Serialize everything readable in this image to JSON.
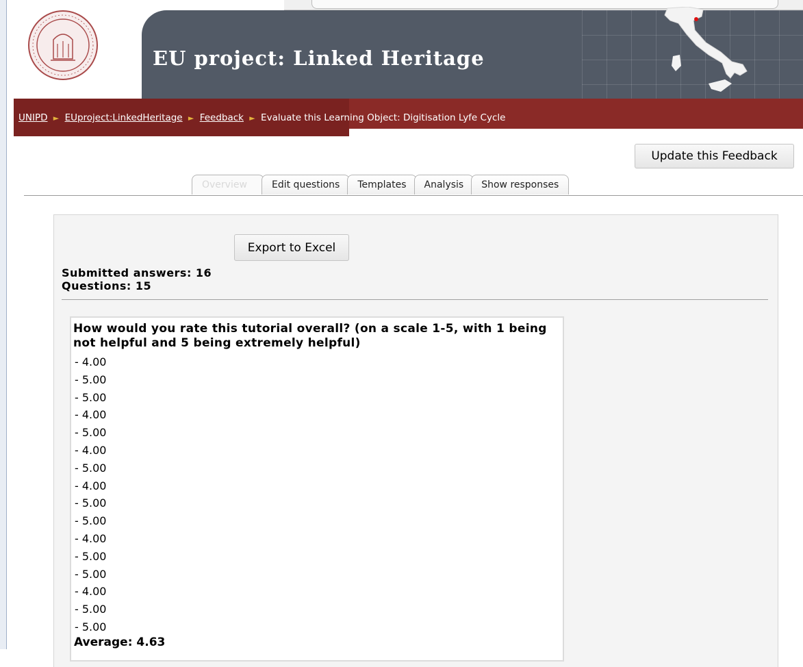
{
  "header": {
    "title": "EU project: Linked Heritage"
  },
  "breadcrumb": {
    "items": [
      {
        "label": "UNIPD",
        "link": true
      },
      {
        "label": "EUproject:LinkedHeritage",
        "link": true
      },
      {
        "label": "Feedback",
        "link": true
      },
      {
        "label": "Evaluate this Learning Object: Digitisation Lyfe Cycle",
        "link": false
      }
    ]
  },
  "actions": {
    "update_label": "Update this Feedback",
    "export_label": "Export to Excel"
  },
  "tabs": [
    {
      "label": "Overview",
      "active": true
    },
    {
      "label": "Edit questions",
      "active": false
    },
    {
      "label": "Templates",
      "active": false
    },
    {
      "label": "Analysis",
      "active": false
    },
    {
      "label": "Show responses",
      "active": false
    }
  ],
  "stats": {
    "submitted": "Submitted answers: 16",
    "questions": "Questions: 15"
  },
  "question": {
    "text": "How would you rate this tutorial overall? (on a scale 1-5, with 1 being not helpful and 5 being extremely helpful)",
    "answers": [
      "- 4.00",
      "- 5.00",
      "- 5.00",
      "- 4.00",
      "- 5.00",
      "- 4.00",
      "- 5.00",
      "- 4.00",
      "- 5.00",
      "- 5.00",
      "- 4.00",
      "- 5.00",
      "- 5.00",
      "- 4.00",
      "- 5.00",
      "- 5.00"
    ],
    "average": "Average: 4.63"
  },
  "colors": {
    "header_grey": "#525a66",
    "crumb_red": "#7a2220",
    "crumb_arrow": "#e3b23c"
  }
}
